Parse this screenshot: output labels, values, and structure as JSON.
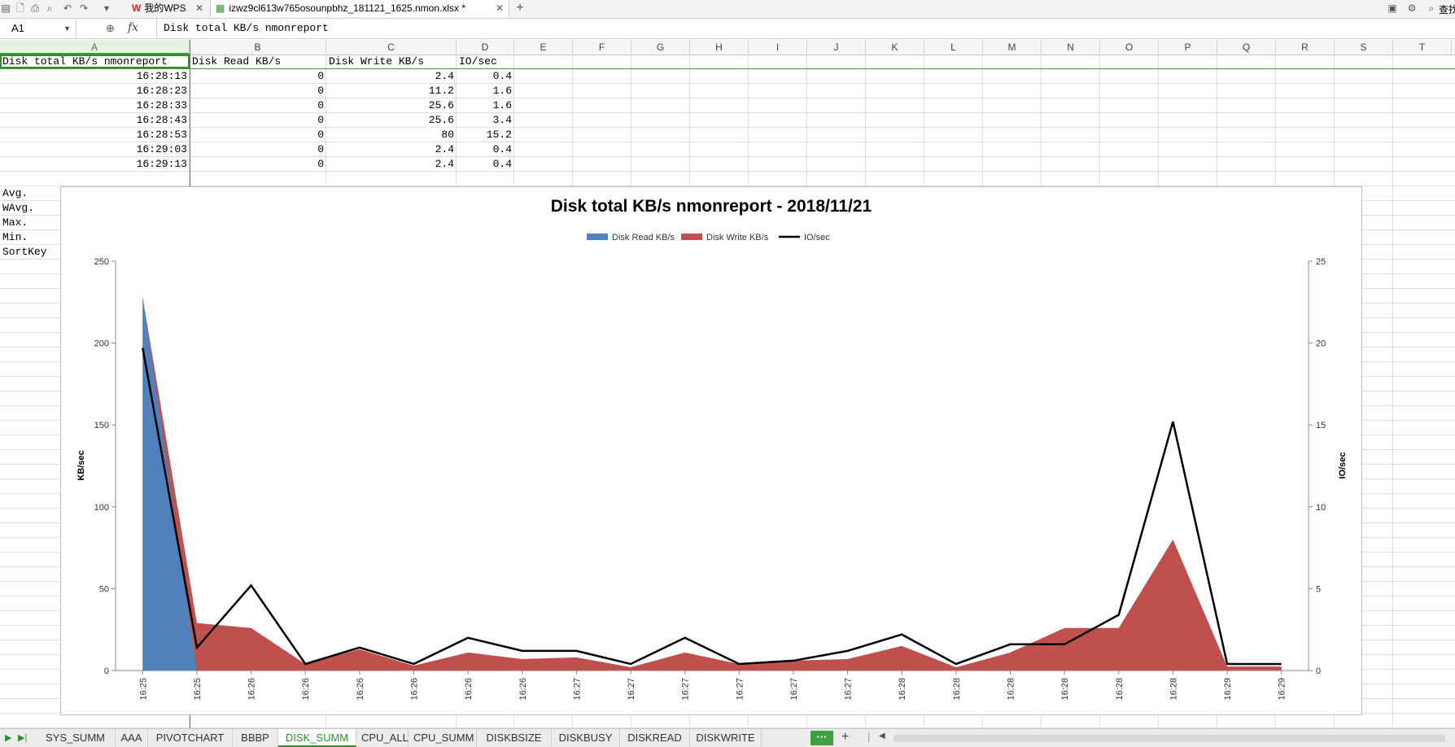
{
  "titlebar": {
    "wps_tab_label": "我的WPS",
    "file_tab_label": "izwz9cl613w765osounpbhz_181121_1625.nmon.xlsx *",
    "right_label": "查找"
  },
  "formula_bar": {
    "cell_ref": "A1",
    "fx": "fx",
    "content": "Disk total KB/s nmonreport"
  },
  "columns": [
    "A",
    "B",
    "C",
    "D",
    "E",
    "F",
    "G",
    "H",
    "I",
    "J",
    "K",
    "L",
    "M",
    "N",
    "O",
    "P",
    "Q",
    "R",
    "S",
    "T"
  ],
  "table": {
    "header": [
      "Disk total KB/s nmonreport",
      "Disk Read KB/s",
      "Disk Write KB/s",
      "IO/sec"
    ],
    "rows": [
      [
        "16:28:13",
        "0",
        "2.4",
        "0.4"
      ],
      [
        "16:28:23",
        "0",
        "11.2",
        "1.6"
      ],
      [
        "16:28:33",
        "0",
        "25.6",
        "1.6"
      ],
      [
        "16:28:43",
        "0",
        "25.6",
        "3.4"
      ],
      [
        "16:28:53",
        "0",
        "80",
        "15.2"
      ],
      [
        "16:29:03",
        "0",
        "2.4",
        "0.4"
      ],
      [
        "16:29:13",
        "0",
        "2.4",
        "0.4"
      ]
    ],
    "stats_labels": [
      "Avg.",
      "WAvg.",
      "Max.",
      "Min.",
      "SortKey"
    ]
  },
  "chart_data": {
    "type": "area",
    "title": "Disk total KB/s nmonreport - 2018/11/21",
    "ylabel": "KB/sec",
    "y2label": "IO/sec",
    "ylim": [
      0,
      250
    ],
    "y2lim": [
      0,
      25
    ],
    "yticks": [
      0,
      50,
      100,
      150,
      200,
      250
    ],
    "y2ticks": [
      0,
      5,
      10,
      15,
      20,
      25
    ],
    "categories": [
      "16:25",
      "16:25",
      "16:26",
      "16:26",
      "16:26",
      "16:26",
      "16:26",
      "16:26",
      "16:27",
      "16:27",
      "16:27",
      "16:27",
      "16:27",
      "16:27",
      "16:28",
      "16:28",
      "16:28",
      "16:28",
      "16:28",
      "16:28",
      "16:29",
      "16:29"
    ],
    "legend_position": "top",
    "series": [
      {
        "name": "Disk Read KB/s",
        "kind": "area",
        "axis": "left",
        "color": "#4f81bd",
        "values": [
          228,
          0,
          0,
          0,
          0,
          0,
          0,
          0,
          0,
          0,
          0,
          0,
          0,
          0,
          0,
          0,
          0,
          0,
          0,
          0,
          0,
          0
        ]
      },
      {
        "name": "Disk Write KB/s",
        "kind": "area",
        "axis": "left",
        "color": "#c0504d",
        "values": [
          228,
          29,
          26,
          4,
          13,
          3,
          11,
          7,
          8,
          2,
          11,
          4,
          6,
          7,
          15,
          2,
          11,
          26,
          26,
          80,
          2.4,
          2.4
        ]
      },
      {
        "name": "IO/sec",
        "kind": "line",
        "axis": "right",
        "color": "#000000",
        "values": [
          19.7,
          1.4,
          5.2,
          0.4,
          1.4,
          0.4,
          2.0,
          1.2,
          1.2,
          0.4,
          2.0,
          0.4,
          0.6,
          1.2,
          2.2,
          0.4,
          1.6,
          1.6,
          3.4,
          15.2,
          0.4,
          0.4
        ]
      }
    ]
  },
  "sheets": [
    "SYS_SUMM",
    "AAA",
    "PIVOTCHART",
    "BBBP",
    "DISK_SUMM",
    "CPU_ALL",
    "CPU_SUMM",
    "DISKBSIZE",
    "DISKBUSY",
    "DISKREAD",
    "DISKWRITE"
  ],
  "active_sheet": "DISK_SUMM",
  "sheet_more_label": "···",
  "sheet_add_label": "+",
  "colors": {
    "accent": "#2f8f2f",
    "read": "#4f81bd",
    "write": "#c0504d"
  }
}
